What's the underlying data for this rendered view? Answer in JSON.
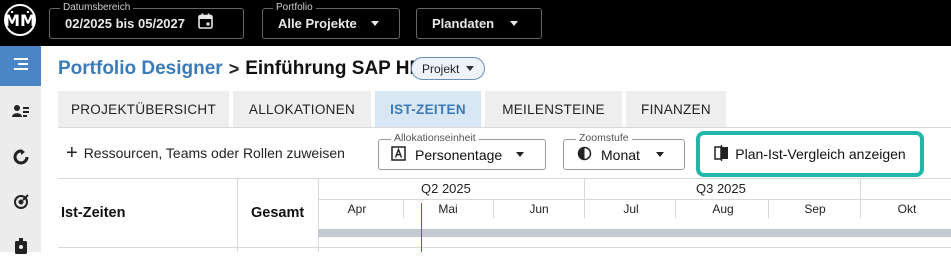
{
  "topbar": {
    "logo_text": "ṀṀ",
    "date_range": {
      "legend": "Datumsbereich",
      "value": "02/2025 bis 05/2027"
    },
    "portfolio": {
      "legend": "Portfolio",
      "value": "Alle Projekte"
    },
    "data_mode": {
      "value": "Plandaten"
    }
  },
  "sidebar": {
    "items": [
      {
        "icon": "menu-lines-icon",
        "active": true
      },
      {
        "icon": "people-list-icon",
        "active": false
      },
      {
        "icon": "refresh-cycle-icon",
        "active": false
      },
      {
        "icon": "target-check-icon",
        "active": false
      },
      {
        "icon": "badge-icon",
        "active": false
      }
    ]
  },
  "header": {
    "breadcrumb_link": "Portfolio Designer",
    "separator": ">",
    "title": "Einführung SAP HR",
    "type_chip": "Projekt"
  },
  "tabs": [
    {
      "label": "PROJEKTÜBERSICHT",
      "active": false
    },
    {
      "label": "ALLOKATIONEN",
      "active": false
    },
    {
      "label": "IST-ZEITEN",
      "active": true
    },
    {
      "label": "MEILENSTEINE",
      "active": false
    },
    {
      "label": "FINANZEN",
      "active": false
    }
  ],
  "toolbar": {
    "assign_label": "Ressourcen, Teams oder Rollen zuweisen",
    "allocation_unit": {
      "legend": "Allokationseinheit",
      "value": "Personentage"
    },
    "zoom": {
      "legend": "Zoomstufe",
      "value": "Monat"
    },
    "compare_label": "Plan-Ist-Vergleich anzeigen"
  },
  "grid": {
    "col_name": "Ist-Zeiten",
    "col_total": "Gesamt",
    "quarters": [
      "Q2 2025",
      "Q3 2025"
    ],
    "months": [
      "Apr",
      "Mai",
      "Jun",
      "Jul",
      "Aug",
      "Sep",
      "Okt"
    ]
  },
  "colors": {
    "accent": "#3a7bb8",
    "active_sidebar": "#4a86c5",
    "highlight_outline": "#1fb7a9",
    "today_marker": "#d9332c"
  }
}
